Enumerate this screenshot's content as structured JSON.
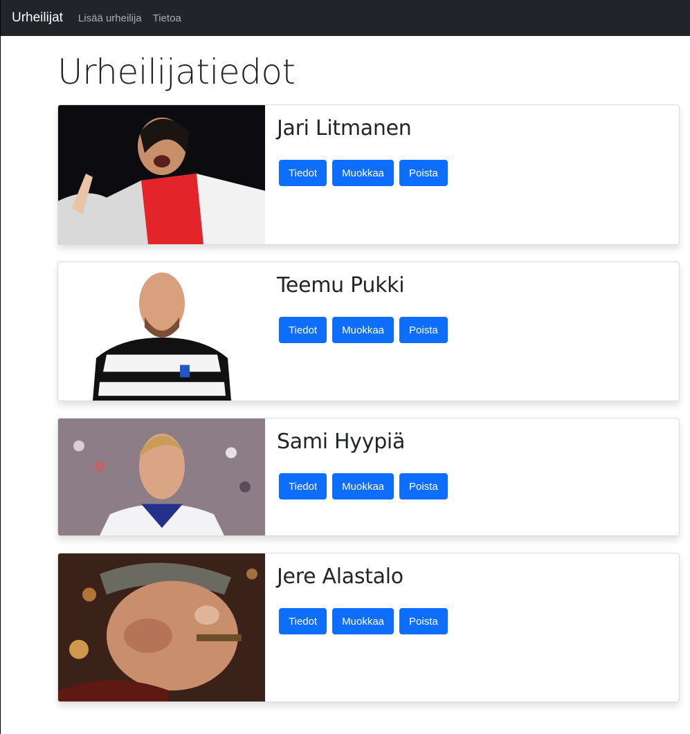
{
  "navbar": {
    "brand": "Urheilijat",
    "links": [
      "Lisää urheilija",
      "Tietoa"
    ]
  },
  "main": {
    "title": "Urheilijatiedot"
  },
  "buttons": {
    "details": "Tiedot",
    "edit": "Muokkaa",
    "delete": "Poista"
  },
  "athletes": [
    {
      "name": "Jari Litmanen",
      "photo": "player-photo-red-white-kit"
    },
    {
      "name": "Teemu Pukki",
      "photo": "player-photo-finland-kit"
    },
    {
      "name": "Sami Hyypiä",
      "photo": "player-photo-stadium-crowd"
    },
    {
      "name": "Jere Alastalo",
      "photo": "cartoon-sailor-photo"
    }
  ],
  "colors": {
    "navbar": "#212529",
    "primary_button": "#0d6efd"
  }
}
